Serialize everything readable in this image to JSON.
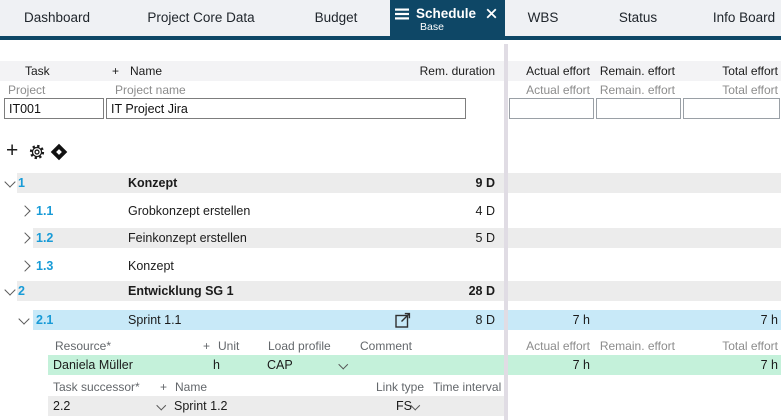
{
  "tab_bar": {
    "tabs": [
      {
        "label": "Dashboard"
      },
      {
        "label": "Project Core Data"
      },
      {
        "label": "Budget"
      },
      {
        "label": "Schedule",
        "sublabel": "Base",
        "active": true
      },
      {
        "label": "WBS"
      },
      {
        "label": "Status"
      },
      {
        "label": "Info Board"
      }
    ]
  },
  "table_header": {
    "task": "Task",
    "plus": "+",
    "name": "Name",
    "rem_duration": "Rem. duration",
    "actual_effort": "Actual effort",
    "remain_effort": "Remain. effort",
    "total_effort": "Total effort"
  },
  "project_row": {
    "type_label": "Project",
    "name_label": "Project name",
    "actual_label": "Actual effort",
    "remain_label": "Remain. effort",
    "total_label": "Total effort",
    "id_value": "IT001",
    "name_value": "IT Project Jira",
    "actual_value": "",
    "remain_value": "",
    "total_value": ""
  },
  "toolbar": {
    "icons": [
      "plus-icon",
      "gear-icon",
      "milestone-icon"
    ]
  },
  "tasks": [
    {
      "number": "1",
      "name": "Konzept",
      "rem_duration": "9 D"
    },
    {
      "number": "1.1",
      "name": "Grobkonzept erstellen",
      "rem_duration": "4 D"
    },
    {
      "number": "1.2",
      "name": "Feinkonzept erstellen",
      "rem_duration": "5 D"
    },
    {
      "number": "1.3",
      "name": "Konzept",
      "rem_duration": ""
    },
    {
      "number": "2",
      "name": "Entwicklung SG 1",
      "rem_duration": "28 D"
    },
    {
      "number": "2.1",
      "name": "Sprint 1.1",
      "rem_duration": "8 D",
      "actual_effort": "7 h",
      "total_effort": "7 h"
    }
  ],
  "resource_table": {
    "header": {
      "resource": "Resource*",
      "plus": "+",
      "unit": "Unit",
      "load_profile": "Load profile",
      "comment": "Comment",
      "actual_effort": "Actual effort",
      "remain_effort": "Remain. effort",
      "total_effort": "Total effort"
    },
    "rows": [
      {
        "resource": "Daniela Müller",
        "unit": "h",
        "load_profile": "CAP",
        "comment": "",
        "actual_effort": "7 h",
        "total_effort": "7 h"
      }
    ]
  },
  "successor_table": {
    "header": {
      "task_successor": "Task successor*",
      "plus": "+",
      "name": "Name",
      "link_type": "Link type",
      "time_interval": "Time interval"
    },
    "rows": [
      {
        "task": "2.2",
        "name": "Sprint 1.2",
        "link_type": "FS",
        "time_interval": ""
      }
    ]
  },
  "colors": {
    "tab_active_bg": "#0e4766",
    "selected_row_bg": "#c8e9f8",
    "resource_row_bg": "#c4f1da",
    "zebra_row_bg": "#ececec",
    "task_number_blue": "#189bd7",
    "separator": "#e0dce4"
  }
}
